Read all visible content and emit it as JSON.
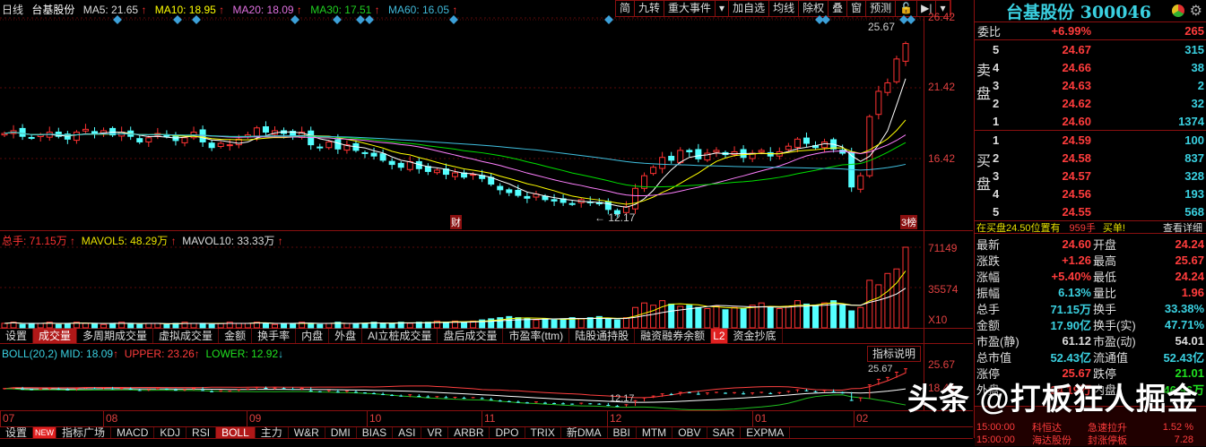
{
  "header": {
    "period": "日线",
    "name": "台基股份",
    "ma5": "MA5: 21.65",
    "ma10": "MA10: 18.95",
    "ma20": "MA20: 18.09",
    "ma30": "MA30: 17.51",
    "ma60": "MA60: 16.05",
    "arrow": "↑"
  },
  "toolbar": [
    "简",
    "九转",
    "重大事件",
    "▾",
    "加自选",
    "均线",
    "除权",
    "叠",
    "窗",
    "预测",
    "🔓",
    "▶|",
    "▾"
  ],
  "price_axis": [
    "26.42",
    "21.42",
    "16.42"
  ],
  "annotations": {
    "high": "25.67",
    "low": "← 12.17",
    "cai": "财",
    "bang": "3榜"
  },
  "volume_header": {
    "total": "总手: 71.15万",
    "mavol5": "MAVOL5: 48.29万",
    "mavol10": "MAVOL10: 33.33万"
  },
  "volume_axis": [
    "71149",
    "35574",
    "X10"
  ],
  "indicator_tabs": [
    "设置",
    "成交量",
    "多周期成交量",
    "虚拟成交量",
    "金额",
    "换手率",
    "内盘",
    "外盘",
    "AI立桩成交量",
    "盘后成交量",
    "市盈率(ttm)",
    "陆股通持股",
    "融资融券余额",
    "L2",
    "资金抄底"
  ],
  "boll_header": {
    "mid": "BOLL(20,2) MID: 18.09",
    "upper": "UPPER: 23.26",
    "lower": "LOWER: 12.92"
  },
  "boll_axis": [
    "25.67",
    "18.44"
  ],
  "boll_labels": {
    "high": "25.67",
    "low": "12.17",
    "help": "指标说明"
  },
  "date_axis": [
    "07",
    "08",
    "09",
    "10",
    "11",
    "12",
    "01",
    "02"
  ],
  "bottom_tabs": [
    "设置",
    "NEW",
    "指标广场",
    "MACD",
    "KDJ",
    "RSI",
    "BOLL",
    "主力",
    "W&R",
    "DMI",
    "BIAS",
    "ASI",
    "VR",
    "ARBR",
    "DPO",
    "TRIX",
    "新DMA",
    "BBI",
    "MTM",
    "OBV",
    "SAR",
    "EXPMA"
  ],
  "quote": {
    "title": "台基股份 300046",
    "weibi_label": "委比",
    "weibi": "+6.99%",
    "weicha": "265",
    "sell_label": [
      "卖",
      "盘"
    ],
    "buy_label": [
      "买",
      "盘"
    ],
    "sell": [
      {
        "lvl": "5",
        "price": "24.67",
        "vol": "315"
      },
      {
        "lvl": "4",
        "price": "24.66",
        "vol": "38"
      },
      {
        "lvl": "3",
        "price": "24.63",
        "vol": "2"
      },
      {
        "lvl": "2",
        "price": "24.62",
        "vol": "32"
      },
      {
        "lvl": "1",
        "price": "24.60",
        "vol": "1374"
      }
    ],
    "buy": [
      {
        "lvl": "1",
        "price": "24.59",
        "vol": "100"
      },
      {
        "lvl": "2",
        "price": "24.58",
        "vol": "837"
      },
      {
        "lvl": "3",
        "price": "24.57",
        "vol": "328"
      },
      {
        "lvl": "4",
        "price": "24.56",
        "vol": "193"
      },
      {
        "lvl": "5",
        "price": "24.55",
        "vol": "568"
      }
    ],
    "notice": {
      "text": "在买盘24.50位置有",
      "qty": "959手",
      "kind": "买单!",
      "link": "查看详细"
    },
    "stats": [
      [
        "最新",
        "24.60",
        "red",
        "开盘",
        "24.24",
        "red"
      ],
      [
        "涨跌",
        "+1.26",
        "red",
        "最高",
        "25.67",
        "red"
      ],
      [
        "涨幅",
        "+5.40%",
        "red",
        "最低",
        "24.24",
        "red"
      ],
      [
        "振幅",
        "6.13%",
        "cyan",
        "量比",
        "1.96",
        "red"
      ],
      [
        "总手",
        "71.15万",
        "cyan",
        "换手",
        "33.38%",
        "cyan"
      ],
      [
        "金额",
        "17.90亿",
        "cyan",
        "换手(实)",
        "47.71%",
        "cyan"
      ],
      [
        "市盈(静)",
        "61.12",
        "wht",
        "市盈(动)",
        "54.01",
        "wht"
      ],
      [
        "总市值",
        "52.43亿",
        "cyan",
        "流通值",
        "52.43亿",
        "cyan"
      ],
      [
        "涨停",
        "25.67",
        "red",
        "跌停",
        "21.01",
        "grn"
      ],
      [
        "外盘",
        "24.19万",
        "red",
        "内盘",
        "46.96万",
        "grn"
      ]
    ],
    "news": [
      [
        "15:00:00",
        "科恒达",
        "急速拉升",
        "1.52 %"
      ],
      [
        "15:00:00",
        "海达股份",
        "封涨停板",
        "7.28"
      ]
    ]
  },
  "watermark": "头条 @打板狂人掘金",
  "colors": {
    "up": "#ff3232",
    "down": "#54ffff",
    "ma5": "#ffffff",
    "ma10": "#ffff00",
    "ma20": "#ff80ff",
    "ma30": "#00e000",
    "ma60": "#40c0e0"
  },
  "chart_data": {
    "type": "candlestick",
    "closes": [
      18.2,
      18.4,
      18.0,
      17.9,
      18.1,
      18.3,
      18.0,
      17.8,
      18.3,
      18.5,
      18.2,
      18.4,
      18.1,
      18.3,
      18.0,
      17.6,
      17.9,
      18.2,
      18.0,
      17.7,
      17.9,
      18.3,
      17.6,
      17.2,
      17.5,
      17.4,
      17.8,
      18.1,
      18.6,
      18.3,
      18.4,
      18.2,
      18.0,
      18.3,
      17.4,
      17.2,
      17.6,
      17.1,
      17.4,
      17.0,
      16.8,
      16.6,
      16.3,
      16.0,
      15.8,
      16.2,
      15.7,
      15.5,
      15.6,
      15.3,
      15.4,
      15.1,
      15.3,
      15.0,
      14.6,
      14.2,
      14.0,
      13.8,
      13.6,
      13.9,
      13.5,
      13.4,
      13.3,
      13.2,
      13.5,
      13.3,
      13.2,
      12.8,
      12.5,
      13.0,
      14.3,
      15.2,
      15.8,
      16.5,
      16.3,
      17.0,
      16.9,
      16.4,
      16.8,
      17.0,
      16.7,
      16.9,
      16.5,
      16.8,
      17.0,
      16.6,
      16.9,
      17.3,
      17.8,
      17.5,
      17.2,
      17.6,
      17.1,
      16.8,
      14.4,
      15.2,
      19.4,
      21.2,
      21.8,
      23.5,
      24.6
    ],
    "volumes_wan": [
      4,
      5,
      3,
      4,
      4,
      5,
      3,
      4,
      5,
      4,
      4,
      3,
      4,
      5,
      4,
      3,
      4,
      4,
      3,
      4,
      5,
      4,
      4,
      3,
      4,
      5,
      4,
      4,
      5,
      4,
      3,
      4,
      4,
      5,
      4,
      3,
      4,
      5,
      4,
      4,
      4,
      5,
      4,
      4,
      5,
      4,
      5,
      5,
      6,
      5,
      6,
      5,
      6,
      7,
      8,
      9,
      10,
      9,
      8,
      7,
      8,
      7,
      8,
      9,
      8,
      9,
      10,
      8,
      7,
      9,
      18,
      22,
      20,
      24,
      21,
      19,
      20,
      18,
      17,
      19,
      16,
      18,
      17,
      20,
      22,
      18,
      17,
      19,
      24,
      21,
      20,
      22,
      24,
      20,
      15,
      18,
      42,
      38,
      48,
      52,
      71.15
    ],
    "price_range": [
      12.17,
      25.67
    ],
    "ma_periods": [
      5,
      10,
      20,
      30,
      60
    ],
    "boll": {
      "period": 20,
      "k": 2
    }
  }
}
